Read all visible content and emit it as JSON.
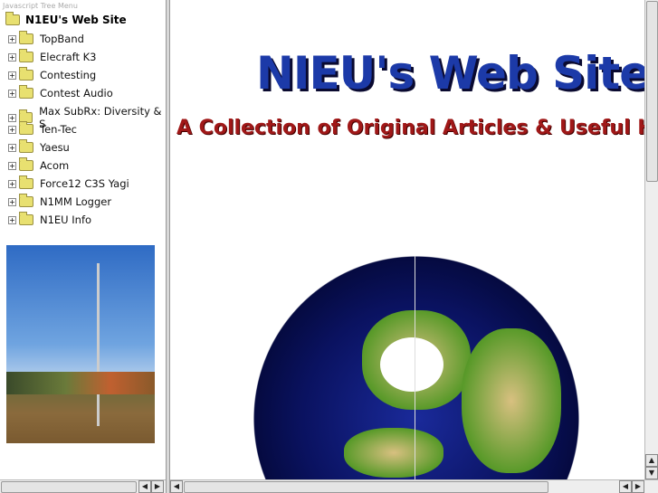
{
  "menu": {
    "caption": "Javascript Tree Menu",
    "root": "N1EU's Web Site",
    "items": [
      "TopBand",
      "Elecraft K3",
      "Contesting",
      "Contest Audio",
      "Max SubRx: Diversity & S",
      "Ten-Tec",
      "Yaesu",
      "Acom",
      "Force12 C3S Yagi",
      "N1MM Logger",
      "N1EU Info"
    ]
  },
  "banner": {
    "title": "NIEU's Web Site",
    "subtitle": "A Collection of Original Articles & Useful H"
  },
  "colors": {
    "title": "#1c3aa8",
    "subtitle": "#a01818"
  }
}
